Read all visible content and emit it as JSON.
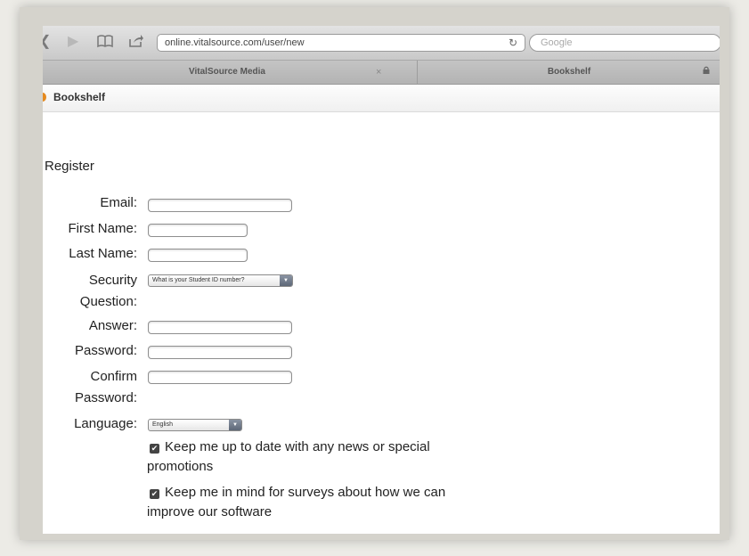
{
  "browser": {
    "url": "online.vitalsource.com/user/new",
    "search_placeholder": "Google",
    "tabs": [
      {
        "label": "VitalSource Media",
        "close": "×"
      },
      {
        "label": "Bookshelf"
      }
    ]
  },
  "app": {
    "title": "Bookshelf"
  },
  "form": {
    "heading": "Register",
    "email_label": "Email:",
    "first_name_label": "First Name:",
    "last_name_label": "Last Name:",
    "security_label_1": "Security",
    "security_label_2": "Question:",
    "security_selected": "What is your Student ID number?",
    "answer_label": "Answer:",
    "password_label": "Password:",
    "confirm_label_1": "Confirm",
    "confirm_label_2": "Password:",
    "language_label": "Language:",
    "language_selected": "English",
    "news_line_1": "Keep me up to date with any news or special",
    "news_line_2": "promotions",
    "survey_line_1": "Keep me in mind for surveys about how we can",
    "survey_line_2": "improve our software"
  },
  "icons": {
    "back": "back-arrow-icon",
    "bookmarks": "book-icon",
    "share": "share-icon",
    "reload": "reload-icon",
    "lock": "lock-icon",
    "checkbox": "checkmark-icon",
    "dropdown": "dropdown-arrow-icon"
  },
  "colors": {
    "accent": "#e58a1f",
    "toolbar": "#d0d0d0",
    "background": "#ffffff"
  }
}
